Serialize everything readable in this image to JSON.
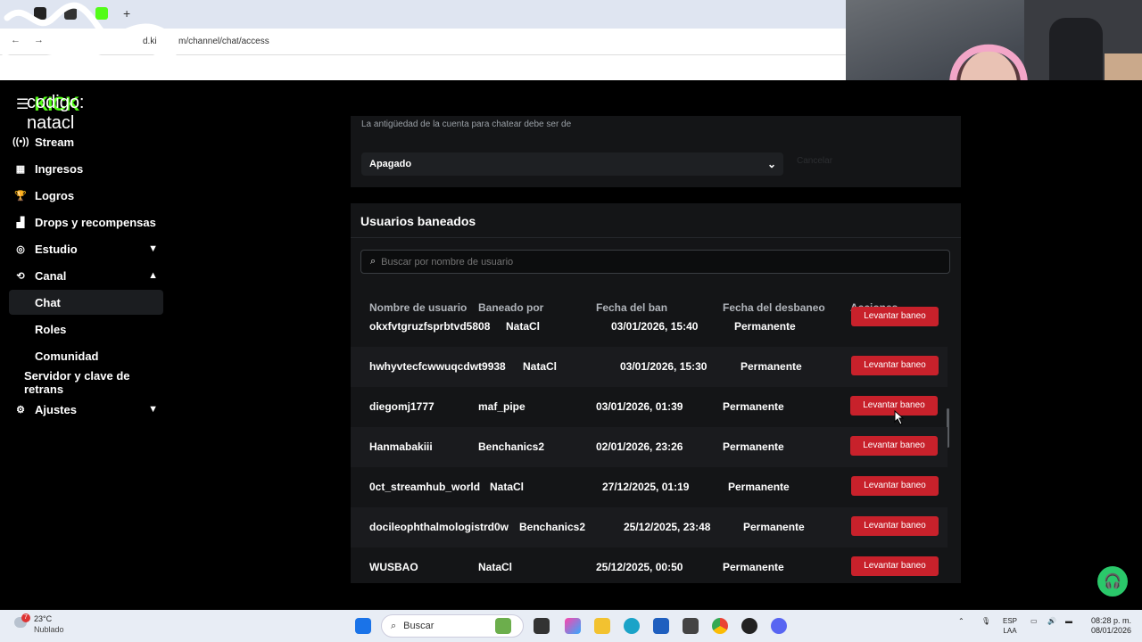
{
  "browser": {
    "address": "m/channel/chat/access",
    "address_prefix": "d.ki"
  },
  "brand": {
    "logo_text": "KICK",
    "overlay_text": "codigo: natacl"
  },
  "sidebar": {
    "items": [
      {
        "label": "Stream",
        "icon": "broadcast-icon"
      },
      {
        "label": "Ingresos",
        "icon": "chart-icon"
      },
      {
        "label": "Logros",
        "icon": "trophy-icon"
      },
      {
        "label": "Drops y recompensas",
        "icon": "drops-icon"
      },
      {
        "label": "Estudio",
        "icon": "studio-icon"
      },
      {
        "label": "Canal",
        "icon": "canal-icon"
      },
      {
        "label": "Chat"
      },
      {
        "label": "Roles"
      },
      {
        "label": "Comunidad"
      },
      {
        "label": "Servidor y clave de retrans"
      },
      {
        "label": "Ajustes",
        "icon": "gear-icon"
      }
    ]
  },
  "account_age": {
    "note": "La antigüedad de la cuenta para chatear debe ser de",
    "selected": "Apagado",
    "cancel": "Cancelar"
  },
  "bans": {
    "title": "Usuarios baneados",
    "search_placeholder": "Buscar por nombre de usuario",
    "headers": [
      "Nombre de usuario",
      "Baneado por",
      "Fecha del ban",
      "Fecha del desbaneo",
      "Acciones"
    ],
    "rows": [
      {
        "user": "okxfvtgruzfsprbtvd5808",
        "by": "NataCl",
        "date": "03/01/2026, 15:40",
        "unban": "Permanente",
        "action": "Levantar baneo"
      },
      {
        "user": "hwhyvtecfcwwuqcdwt9938",
        "by": "NataCl",
        "date": "03/01/2026, 15:30",
        "unban": "Permanente",
        "action": "Levantar baneo"
      },
      {
        "user": "diegomj1777",
        "by": "maf_pipe",
        "date": "03/01/2026, 01:39",
        "unban": "Permanente",
        "action": "Levantar baneo"
      },
      {
        "user": "Hanmabakiii",
        "by": "Benchanics2",
        "date": "02/01/2026, 23:26",
        "unban": "Permanente",
        "action": "Levantar baneo"
      },
      {
        "user": "0ct_streamhub_world",
        "by": "NataCl",
        "date": "27/12/2025, 01:19",
        "unban": "Permanente",
        "action": "Levantar baneo"
      },
      {
        "user": "docileophthalmologistrd0w",
        "by": "Benchanics2",
        "date": "25/12/2025, 23:48",
        "unban": "Permanente",
        "action": "Levantar baneo"
      },
      {
        "user": "WUSBAO",
        "by": "NataCl",
        "date": "25/12/2025, 00:50",
        "unban": "Permanente",
        "action": "Levantar baneo"
      }
    ]
  },
  "taskbar": {
    "temperature": "23°C",
    "weather": "Nublado",
    "weather_badge": "7",
    "search_placeholder": "Buscar",
    "lang_top": "ESP",
    "lang_bottom": "LAA",
    "time": "08:28 p. m.",
    "date": "08/01/2026"
  },
  "colors": {
    "accent_green": "#53fc18",
    "ban_button": "#c8212b",
    "panel": "#141517"
  }
}
